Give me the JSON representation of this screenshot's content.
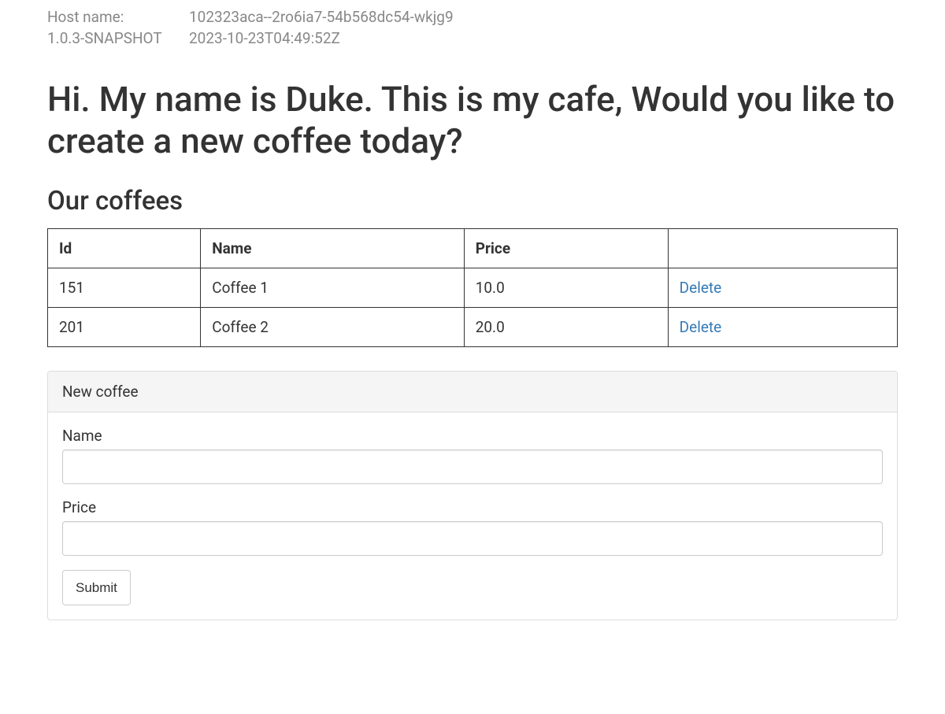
{
  "header": {
    "host_label": "Host name:",
    "host_value": "102323aca--2ro6ia7-54b568dc54-wkjg9",
    "version": "1.0.3-SNAPSHOT",
    "build_time": "2023-10-23T04:49:52Z"
  },
  "main": {
    "title": "Hi. My name is Duke. This is my cafe, Would you like to create a new coffee today?",
    "subtitle": "Our coffees"
  },
  "table": {
    "headers": {
      "id": "Id",
      "name": "Name",
      "price": "Price",
      "action": ""
    },
    "delete_label": "Delete",
    "rows": [
      {
        "id": "151",
        "name": "Coffee 1",
        "price": "10.0"
      },
      {
        "id": "201",
        "name": "Coffee 2",
        "price": "20.0"
      }
    ]
  },
  "form": {
    "panel_title": "New coffee",
    "name_label": "Name",
    "price_label": "Price",
    "submit_label": "Submit"
  }
}
